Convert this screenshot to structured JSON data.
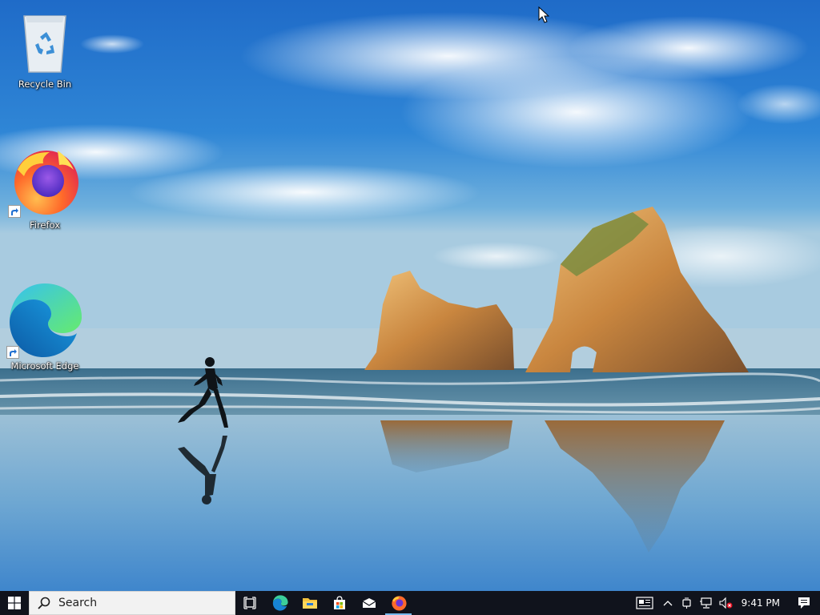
{
  "desktop": {
    "icons": [
      {
        "label": "Recycle Bin",
        "icon": "recycle-bin-icon",
        "shortcut": false
      },
      {
        "label": "Firefox",
        "icon": "firefox-icon",
        "shortcut": true
      },
      {
        "label": "Microsoft Edge",
        "icon": "edge-icon",
        "shortcut": true
      }
    ]
  },
  "taskbar": {
    "search_placeholder": "Search",
    "pinned": [
      {
        "icon": "task-view-icon",
        "active": false
      },
      {
        "icon": "edge-icon",
        "active": false
      },
      {
        "icon": "file-explorer-icon",
        "active": false
      },
      {
        "icon": "store-icon",
        "active": false
      },
      {
        "icon": "mail-icon",
        "active": false
      },
      {
        "icon": "firefox-icon",
        "active": true
      }
    ],
    "tray": {
      "icons": [
        "news-icon",
        "show-hidden-icons-chevron",
        "meet-now-icon",
        "network-icon",
        "volume-muted-icon"
      ],
      "time": "9:41 PM"
    }
  },
  "colors": {
    "taskbar_bg": "#10131c",
    "search_bg": "#f2f2f2",
    "active_indicator": "#76b9ed"
  }
}
